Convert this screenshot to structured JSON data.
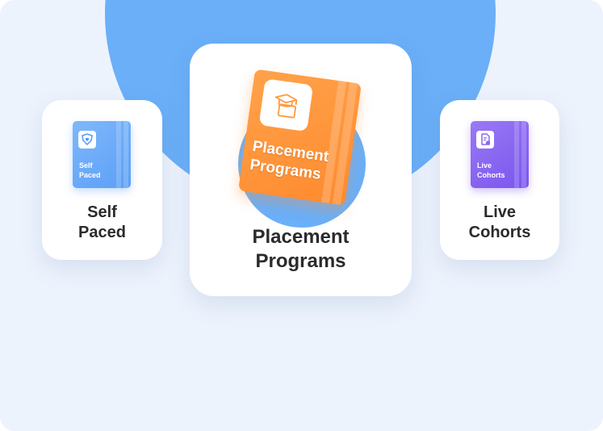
{
  "cards": {
    "left": {
      "label": "Self\nPaced",
      "book_title": "Self\nPaced",
      "icon": "shield-heart-icon",
      "color": "#6aaff8"
    },
    "center": {
      "label": "Placement\nPrograms",
      "book_title": "Placement\nPrograms",
      "icon": "graduation-cap-icon",
      "color": "#ff9a3c"
    },
    "right": {
      "label": "Live\nCohorts",
      "book_title": "Live\nCohorts",
      "icon": "document-user-icon",
      "color": "#8a66f2"
    }
  },
  "background": {
    "color": "#edf3fd",
    "circle_color": "#6aaff8"
  }
}
